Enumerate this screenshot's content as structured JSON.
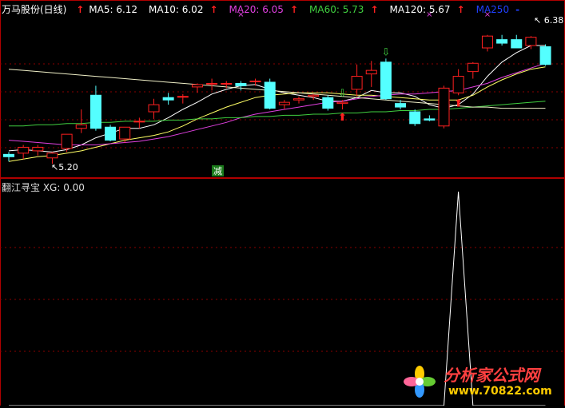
{
  "header": {
    "stock": "万马股份(日线)",
    "indicators": [
      {
        "label": "MA5: 6.12",
        "arrow": "↑",
        "arrow_color": "#ff2020",
        "color": "#ffffff"
      },
      {
        "label": "MA10: 6.02",
        "arrow": "↑",
        "arrow_color": "#ff2020",
        "color": "#ffffff"
      },
      {
        "label": "MA20: 6.05",
        "arrow": "↑",
        "arrow_color": "#ff2020",
        "color": "#e040e0"
      },
      {
        "label": "MA60: 5.73",
        "arrow": "↑",
        "arrow_color": "#ff2020",
        "color": "#40d040"
      },
      {
        "label": "MA120: 5.67",
        "arrow": "↑",
        "arrow_color": "#ff2020",
        "color": "#ffffff"
      },
      {
        "label": "MA250",
        "arrow": "-",
        "arrow_color": "#2040ff",
        "color": "#2040ff"
      }
    ]
  },
  "chart_data": [
    {
      "type": "candlestick",
      "title": "万马股份(日线)",
      "high_label": "6.38",
      "low_label": "5.20",
      "signal_label": "减",
      "ylim": [
        5.1,
        6.45
      ],
      "candles": [
        {
          "o": 5.28,
          "h": 5.3,
          "l": 5.22,
          "c": 5.26
        },
        {
          "o": 5.29,
          "h": 5.36,
          "l": 5.24,
          "c": 5.34
        },
        {
          "o": 5.31,
          "h": 5.36,
          "l": 5.27,
          "c": 5.34
        },
        {
          "o": 5.25,
          "h": 5.3,
          "l": 5.2,
          "c": 5.29
        },
        {
          "o": 5.33,
          "h": 5.45,
          "l": 5.3,
          "c": 5.45
        },
        {
          "o": 5.5,
          "h": 5.66,
          "l": 5.46,
          "c": 5.53
        },
        {
          "o": 5.78,
          "h": 5.86,
          "l": 5.48,
          "c": 5.5
        },
        {
          "o": 5.51,
          "h": 5.53,
          "l": 5.39,
          "c": 5.4
        },
        {
          "o": 5.41,
          "h": 5.51,
          "l": 5.38,
          "c": 5.51
        },
        {
          "o": 5.56,
          "h": 5.59,
          "l": 5.5,
          "c": 5.56
        },
        {
          "o": 5.64,
          "h": 5.75,
          "l": 5.58,
          "c": 5.7
        },
        {
          "o": 5.76,
          "h": 5.8,
          "l": 5.7,
          "c": 5.74
        },
        {
          "o": 5.77,
          "h": 5.79,
          "l": 5.71,
          "c": 5.77
        },
        {
          "o": 5.85,
          "h": 5.88,
          "l": 5.8,
          "c": 5.87
        },
        {
          "o": 5.88,
          "h": 5.92,
          "l": 5.82,
          "c": 5.88
        },
        {
          "o": 5.88,
          "h": 5.9,
          "l": 5.84,
          "c": 5.88
        },
        {
          "o": 5.88,
          "h": 5.9,
          "l": 5.82,
          "c": 5.86
        },
        {
          "o": 5.9,
          "h": 5.92,
          "l": 5.86,
          "c": 5.9
        },
        {
          "o": 5.89,
          "h": 5.92,
          "l": 5.66,
          "c": 5.67
        },
        {
          "o": 5.7,
          "h": 5.74,
          "l": 5.66,
          "c": 5.72
        },
        {
          "o": 5.74,
          "h": 5.77,
          "l": 5.71,
          "c": 5.75
        },
        {
          "o": 5.77,
          "h": 5.79,
          "l": 5.74,
          "c": 5.78
        },
        {
          "o": 5.76,
          "h": 5.78,
          "l": 5.65,
          "c": 5.67
        },
        {
          "o": 5.71,
          "h": 5.74,
          "l": 5.66,
          "c": 5.72
        },
        {
          "o": 5.83,
          "h": 6.04,
          "l": 5.77,
          "c": 5.94
        },
        {
          "o": 5.96,
          "h": 6.07,
          "l": 5.85,
          "c": 5.99
        },
        {
          "o": 6.06,
          "h": 6.09,
          "l": 5.74,
          "c": 5.75
        },
        {
          "o": 5.71,
          "h": 5.74,
          "l": 5.66,
          "c": 5.68
        },
        {
          "o": 5.64,
          "h": 5.66,
          "l": 5.52,
          "c": 5.54
        },
        {
          "o": 5.58,
          "h": 5.61,
          "l": 5.56,
          "c": 5.57
        },
        {
          "o": 5.52,
          "h": 5.86,
          "l": 5.5,
          "c": 5.84
        },
        {
          "o": 5.8,
          "h": 6.0,
          "l": 5.78,
          "c": 5.94
        },
        {
          "o": 5.98,
          "h": 6.06,
          "l": 5.92,
          "c": 6.05
        },
        {
          "o": 6.18,
          "h": 6.29,
          "l": 6.15,
          "c": 6.28
        },
        {
          "o": 6.25,
          "h": 6.29,
          "l": 6.2,
          "c": 6.22
        },
        {
          "o": 6.25,
          "h": 6.29,
          "l": 6.18,
          "c": 6.18
        },
        {
          "o": 6.2,
          "h": 6.28,
          "l": 6.17,
          "c": 6.27
        },
        {
          "o": 6.19,
          "h": 6.21,
          "l": 6.03,
          "c": 6.04
        }
      ],
      "ma_series": [
        {
          "name": "MA5",
          "color": "#ffffff",
          "values": [
            5.31,
            5.32,
            5.31,
            5.3,
            5.32,
            5.36,
            5.42,
            5.46,
            5.5,
            5.5,
            5.53,
            5.59,
            5.66,
            5.72,
            5.79,
            5.83,
            5.86,
            5.87,
            5.83,
            5.8,
            5.78,
            5.76,
            5.73,
            5.73,
            5.76,
            5.82,
            5.8,
            5.8,
            5.77,
            5.7,
            5.67,
            5.7,
            5.79,
            5.94,
            6.06,
            6.14,
            6.2,
            6.2
          ]
        },
        {
          "name": "MA10",
          "color": "#ffff66",
          "values": [
            5.22,
            5.24,
            5.26,
            5.27,
            5.29,
            5.31,
            5.34,
            5.37,
            5.4,
            5.42,
            5.44,
            5.47,
            5.52,
            5.58,
            5.63,
            5.68,
            5.72,
            5.76,
            5.78,
            5.79,
            5.8,
            5.8,
            5.8,
            5.79,
            5.78,
            5.78,
            5.77,
            5.76,
            5.75,
            5.74,
            5.74,
            5.74,
            5.78,
            5.85,
            5.91,
            5.96,
            6.0,
            6.02
          ]
        },
        {
          "name": "MA20",
          "color": "#e040e0",
          "values": [
            5.4,
            5.39,
            5.38,
            5.37,
            5.36,
            5.36,
            5.36,
            5.37,
            5.38,
            5.39,
            5.41,
            5.43,
            5.46,
            5.49,
            5.52,
            5.55,
            5.59,
            5.62,
            5.64,
            5.66,
            5.68,
            5.7,
            5.72,
            5.73,
            5.75,
            5.77,
            5.78,
            5.79,
            5.79,
            5.8,
            5.81,
            5.82,
            5.85,
            5.88,
            5.93,
            5.97,
            6.01,
            6.05
          ]
        },
        {
          "name": "MA60",
          "color": "#40d040",
          "values": [
            5.52,
            5.52,
            5.53,
            5.53,
            5.54,
            5.54,
            5.55,
            5.55,
            5.56,
            5.56,
            5.56,
            5.57,
            5.57,
            5.58,
            5.58,
            5.59,
            5.59,
            5.6,
            5.6,
            5.61,
            5.61,
            5.62,
            5.62,
            5.63,
            5.63,
            5.64,
            5.64,
            5.65,
            5.65,
            5.66,
            5.66,
            5.67,
            5.68,
            5.69,
            5.7,
            5.71,
            5.72,
            5.73
          ]
        },
        {
          "name": "MA120",
          "color": "#f0f0c8",
          "values": [
            6.0,
            5.99,
            5.98,
            5.97,
            5.96,
            5.95,
            5.94,
            5.93,
            5.92,
            5.91,
            5.9,
            5.89,
            5.88,
            5.87,
            5.86,
            5.85,
            5.84,
            5.83,
            5.82,
            5.81,
            5.8,
            5.79,
            5.78,
            5.77,
            5.76,
            5.75,
            5.74,
            5.73,
            5.72,
            5.71,
            5.7,
            5.69,
            5.68,
            5.68,
            5.67,
            5.67,
            5.67,
            5.67
          ]
        }
      ],
      "top_markers": [
        16,
        29,
        33
      ],
      "green_down_arrows": [
        23,
        26
      ],
      "red_up_arrows": [
        23,
        31
      ]
    },
    {
      "type": "line",
      "title": "翻江寻宝 XG: 0.00",
      "ylim": [
        0,
        1
      ],
      "spike_index": 31,
      "values": [
        0,
        0,
        0,
        0,
        0,
        0,
        0,
        0,
        0,
        0,
        0,
        0,
        0,
        0,
        0,
        0,
        0,
        0,
        0,
        0,
        0,
        0,
        0,
        0,
        0,
        0,
        0,
        0,
        0,
        0,
        0,
        1,
        0,
        0,
        0,
        0,
        0,
        0
      ]
    }
  ],
  "watermark": {
    "title": "分析家公式网",
    "url": "www.70822.com"
  }
}
